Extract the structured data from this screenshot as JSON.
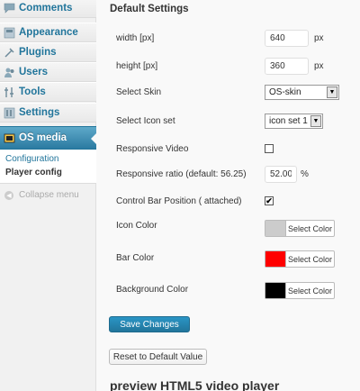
{
  "sidebar": {
    "items": [
      {
        "label": "Comments",
        "icon": "comments-icon"
      },
      {
        "label": "Appearance",
        "icon": "appearance-icon"
      },
      {
        "label": "Plugins",
        "icon": "plugins-icon"
      },
      {
        "label": "Users",
        "icon": "users-icon"
      },
      {
        "label": "Tools",
        "icon": "tools-icon"
      },
      {
        "label": "Settings",
        "icon": "settings-icon"
      },
      {
        "label": "OS media",
        "icon": "os-media-icon",
        "active": true
      }
    ],
    "submenu": [
      "Configuration",
      "Player config"
    ],
    "collapse_label": "Collapse menu"
  },
  "main": {
    "section_title": "Default Settings",
    "width": {
      "label": "width [px]",
      "value": "640",
      "unit": "px"
    },
    "height": {
      "label": "height [px]",
      "value": "360",
      "unit": "px"
    },
    "skin": {
      "label": "Select Skin",
      "value": "OS-skin"
    },
    "icon_set": {
      "label": "Select Icon set",
      "value": "icon set 1"
    },
    "responsive_video": {
      "label": "Responsive Video",
      "checked": false
    },
    "responsive_ratio": {
      "label": "Responsive ratio (default: 56.25)",
      "value": "52.00",
      "unit": "%"
    },
    "control_bar": {
      "label": "Control Bar Position ( attached)",
      "checked": true,
      "check_glyph": "✔"
    },
    "icon_color": {
      "label": "Icon Color",
      "swatch": "#cccccc",
      "button": "Select Color"
    },
    "bar_color": {
      "label": "Bar Color",
      "swatch": "#ff0000",
      "button": "Select Color"
    },
    "background_color": {
      "label": "Background Color",
      "swatch": "#000000",
      "button": "Select Color"
    },
    "save_button": "Save Changes",
    "reset_button": "Reset to Default Value",
    "preview_title": "preview HTML5 video player"
  },
  "colors": {
    "accent": "#21759b",
    "active_menu": "#2b7aa1"
  }
}
